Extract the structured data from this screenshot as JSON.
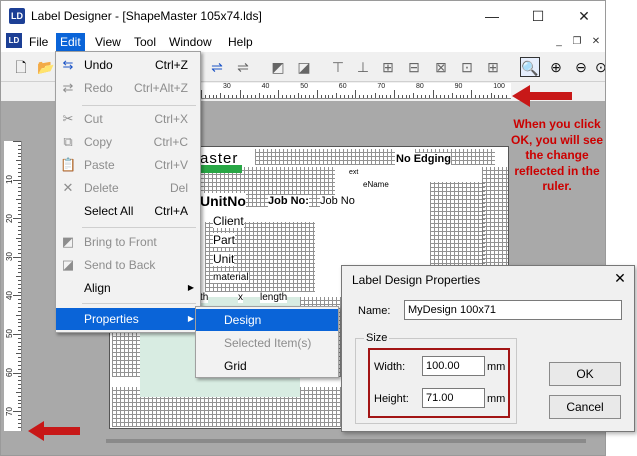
{
  "window": {
    "title": "Label Designer - [ShapeMaster 105x74.lds]",
    "app_icon_text": "LD",
    "controls": {
      "minimize": "—",
      "maximize": "☐",
      "close": "✕"
    },
    "mdi_controls": {
      "minimize": "_",
      "restore": "❐",
      "close": "✕"
    }
  },
  "menubar": [
    "File",
    "Edit",
    "View",
    "Tool",
    "Window",
    "Help"
  ],
  "ruler": {
    "labels": [
      "30",
      "40",
      "50",
      "60",
      "70",
      "80",
      "90",
      "100"
    ]
  },
  "vruler": {
    "labels": [
      "10",
      "20",
      "30",
      "40",
      "50",
      "60",
      "70"
    ]
  },
  "label_canvas": {
    "texts": {
      "brand": "aster",
      "no_edging": "No Edging",
      "ext": "ext",
      "ename": "eName",
      "unit_no": "UnitNo",
      "job_no_label": "Job No:",
      "job_no_value": "Job No",
      "client": "Client",
      "part": "Part",
      "unit": "Unit",
      "material": "material",
      "width": "th",
      "x": "x",
      "length": "length"
    }
  },
  "edit_menu": {
    "items": [
      {
        "label": "Undo",
        "shortcut": "Ctrl+Z",
        "icon": "undo-icon",
        "enabled": true
      },
      {
        "label": "Redo",
        "shortcut": "Ctrl+Alt+Z",
        "icon": "redo-icon",
        "enabled": false
      },
      {
        "label": "Cut",
        "shortcut": "Ctrl+X",
        "icon": "cut-icon",
        "enabled": false
      },
      {
        "label": "Copy",
        "shortcut": "Ctrl+C",
        "icon": "copy-icon",
        "enabled": false
      },
      {
        "label": "Paste",
        "shortcut": "Ctrl+V",
        "icon": "paste-icon",
        "enabled": false
      },
      {
        "label": "Delete",
        "shortcut": "Del",
        "icon": "delete-icon",
        "enabled": false
      },
      {
        "label": "Select All",
        "shortcut": "Ctrl+A",
        "icon": "",
        "enabled": true
      },
      {
        "label": "Bring to Front",
        "shortcut": "",
        "icon": "bring-to-front-icon",
        "enabled": false
      },
      {
        "label": "Send to Back",
        "shortcut": "",
        "icon": "send-to-back-icon",
        "enabled": false
      },
      {
        "label": "Align",
        "shortcut": "",
        "icon": "",
        "enabled": true
      },
      {
        "label": "Properties",
        "shortcut": "",
        "icon": "",
        "enabled": true
      }
    ]
  },
  "properties_submenu": {
    "items": [
      {
        "label": "Design",
        "enabled": true
      },
      {
        "label": "Selected Item(s)",
        "enabled": false
      },
      {
        "label": "Grid",
        "enabled": true
      }
    ]
  },
  "dialog": {
    "title": "Label Design Properties",
    "name_label": "Name:",
    "name_value": "MyDesign 100x71",
    "size_group": "Size",
    "width_label": "Width:",
    "width_value": "100.00",
    "width_unit": "mm",
    "height_label": "Height:",
    "height_value": "71.00",
    "height_unit": "mm",
    "ok": "OK",
    "cancel": "Cancel"
  },
  "annotation": {
    "text": "When you click OK, you will see the change reflected in the ruler.",
    "color": "#cc0000"
  },
  "colors": {
    "accent": "#0a64d8",
    "highlight_box": "#a31515",
    "workspace": "#a9a9a9"
  }
}
